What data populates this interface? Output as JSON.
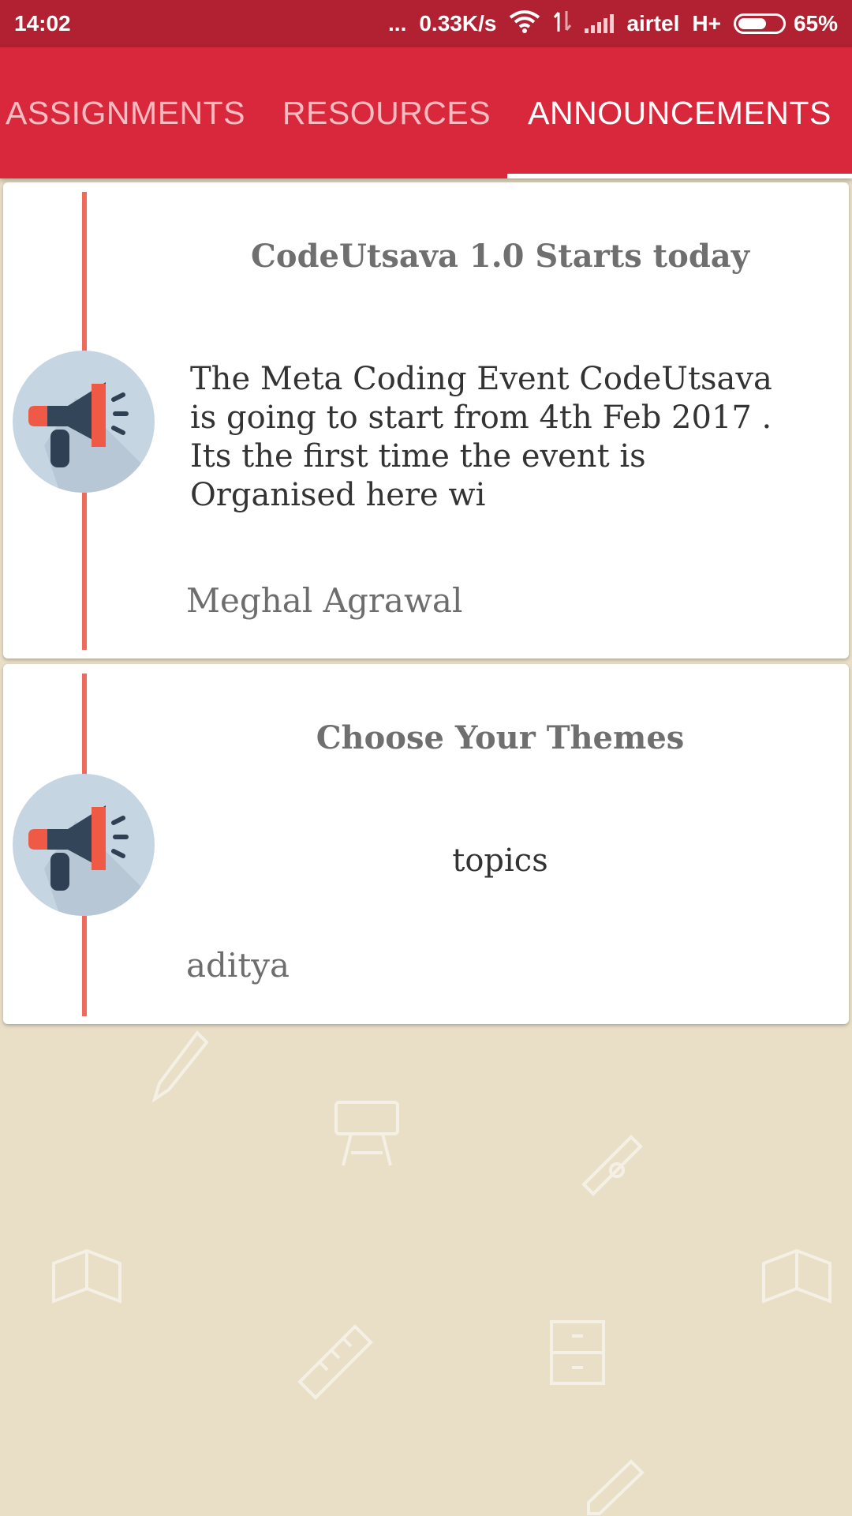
{
  "status_bar": {
    "time": "14:02",
    "more": "...",
    "speed": "0.33K/s",
    "carrier": "airtel",
    "network": "H+",
    "battery_percent": "65%",
    "battery_level": 0.65
  },
  "tabs": [
    {
      "label": "ASSIGNMENTS",
      "active": false
    },
    {
      "label": "RESOURCES",
      "active": false
    },
    {
      "label": "ANNOUNCEMENTS",
      "active": true
    }
  ],
  "announcements": [
    {
      "title": "CodeUtsava 1.0 Starts today",
      "body": "The Meta Coding Event CodeUtsava is going to start from 4th Feb 2017 . Its the first time the event is Organised here wi",
      "author": "Meghal Agrawal",
      "icon": "megaphone-icon"
    },
    {
      "title": "Choose Your Themes",
      "body": "topics",
      "author": "aditya",
      "icon": "megaphone-icon"
    }
  ],
  "colors": {
    "status_bar": "#b22131",
    "tab_bar": "#d9283b",
    "timeline": "#f06a5b",
    "background": "#e9dec6"
  }
}
